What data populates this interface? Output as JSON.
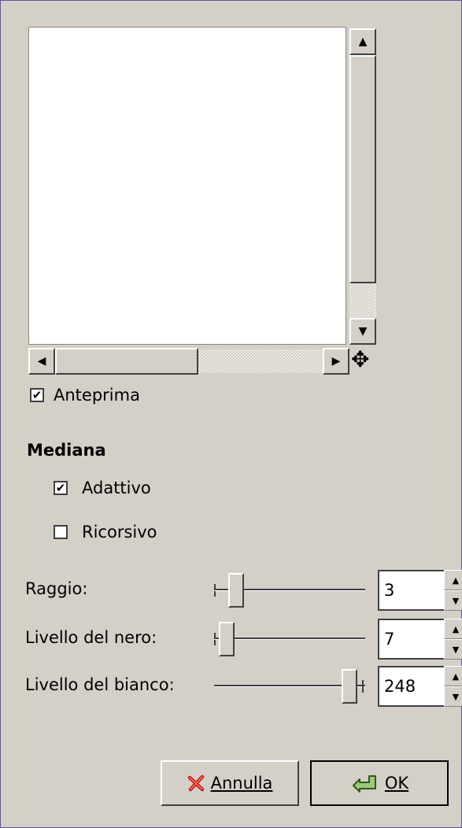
{
  "preview": {
    "checkbox_label": "Anteprima",
    "checked": true
  },
  "section": {
    "title": "Mediana"
  },
  "options": [
    {
      "label": "Adattivo",
      "checked": true
    },
    {
      "label": "Ricorsivo",
      "checked": false
    }
  ],
  "params": [
    {
      "label": "Raggio:",
      "value": "3"
    },
    {
      "label": "Livello del nero:",
      "value": "7"
    },
    {
      "label": "Livello del bianco:",
      "value": "248"
    }
  ],
  "buttons": {
    "cancel_label": "Annulla",
    "ok_label": "OK"
  },
  "icons": {
    "scroll_up": "▲",
    "scroll_down": "▼",
    "scroll_left": "◀",
    "scroll_right": "▶",
    "navigate": "✥",
    "check": "✔"
  }
}
